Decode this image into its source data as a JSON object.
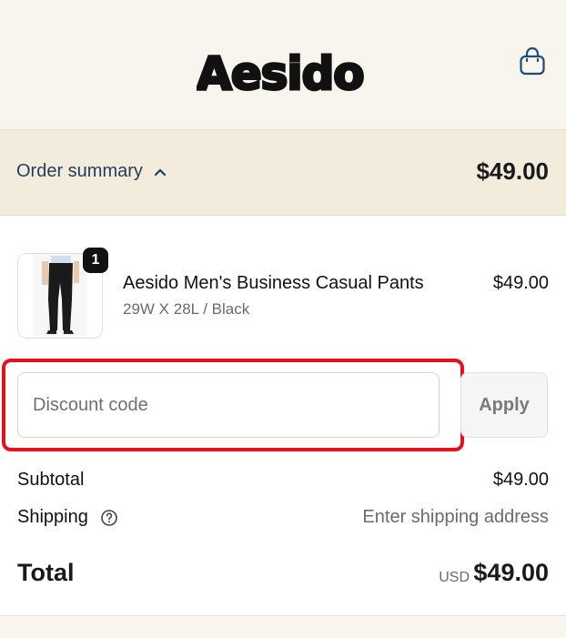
{
  "header": {
    "brand": "Aesido",
    "cart_icon": "shopping-bag-icon"
  },
  "summary": {
    "toggle_label": "Order summary",
    "toggle_icon": "chevron-up-icon",
    "total": "$49.00"
  },
  "product": {
    "quantity": "1",
    "name": "Aesido Men's Business Casual Pants",
    "variant": "29W X 28L / Black",
    "price": "$49.00"
  },
  "discount": {
    "placeholder": "Discount code",
    "value": "",
    "apply_label": "Apply"
  },
  "totals": {
    "subtotal_label": "Subtotal",
    "subtotal_value": "$49.00",
    "shipping_label": "Shipping",
    "shipping_value": "Enter shipping address",
    "total_label": "Total",
    "currency": "USD",
    "total_value": "$49.00"
  },
  "colors": {
    "header_bg": "#f8f5ef",
    "summary_bg": "#f3ebdc",
    "link": "#1f3f5c",
    "highlight": "#e8111b"
  }
}
